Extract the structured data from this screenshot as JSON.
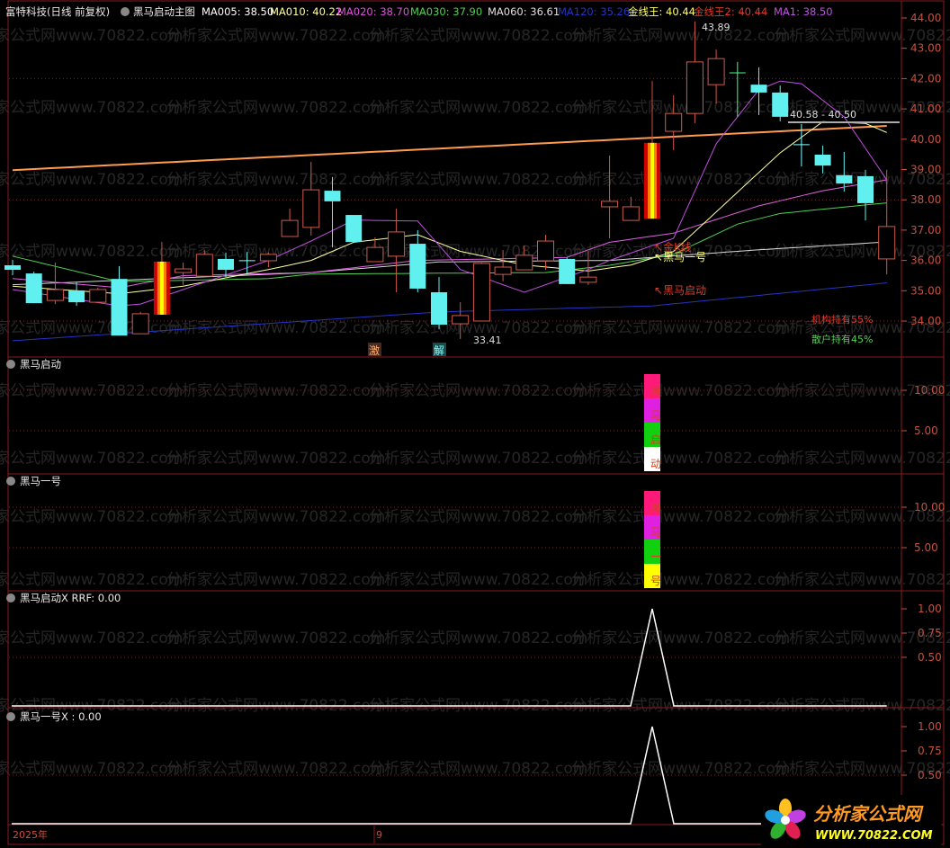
{
  "header": {
    "stock": "富特科技(日线 前复权)",
    "formula": "黑马启动主图",
    "indicators": [
      {
        "label": "MA005: 38.50",
        "color": "#ffffff"
      },
      {
        "label": "MA010: 40.22",
        "color": "#ffffa0"
      },
      {
        "label": "MA020: 38.70",
        "color": "#e050e0"
      },
      {
        "label": "MA030: 37.90",
        "color": "#50d050"
      },
      {
        "label": "MA060: 36.61",
        "color": "#e0e0e0"
      },
      {
        "label": "MA120: 35.26",
        "color": "#2535c0"
      },
      {
        "label": "金线王: 40.44",
        "color": "#ffff70"
      },
      {
        "label": "金线王2: 40.44",
        "color": "#e03a28"
      },
      {
        "label": "MA1: 38.50",
        "color": "#c050e0"
      }
    ]
  },
  "watermark": "分析家公式网www.70822.com",
  "panels": {
    "p2_title": "黑马启动",
    "p3_title": "黑马一号",
    "p4_title": "黑马启动X RRF: 0.00",
    "p5_title": "黑马一号X : 0.00"
  },
  "annotations": {
    "high_label": "43.89",
    "low_label": "33.41",
    "range_label": "40.58 - 40.50",
    "gold_k": "金K线",
    "heima_1": "黑马一号",
    "heima_start": "黑马启动",
    "ji": "激",
    "jie": "解",
    "inst": "机构持有55%",
    "retail": "散户持有45%"
  },
  "date_axis": {
    "year": "2025年",
    "month": "9"
  },
  "logo": {
    "name": "分析家公式网",
    "url": "WWW.70822.COM"
  },
  "chart_data": [
    {
      "type": "candlestick",
      "title": "黑马启动主图",
      "ylim": [
        33.3,
        44.4
      ],
      "yticks": [
        "44.00",
        "43.00",
        "42.00",
        "41.00",
        "40.00",
        "39.00",
        "38.00",
        "37.00",
        "36.00",
        "35.00",
        "34.00"
      ],
      "candles": [
        {
          "o": 35.84,
          "c": 35.69,
          "h": 36.02,
          "l": 35.51
        },
        {
          "o": 35.57,
          "c": 34.59,
          "h": 35.63,
          "l": 34.59
        },
        {
          "o": 34.68,
          "c": 35.04,
          "h": 35.93,
          "l": 34.56
        },
        {
          "o": 35.01,
          "c": 34.62,
          "h": 35.28,
          "l": 34.5
        },
        {
          "o": 34.62,
          "c": 35.04,
          "h": 35.1,
          "l": 34.62
        },
        {
          "o": 35.39,
          "c": 33.52,
          "h": 35.81,
          "l": 33.52
        },
        {
          "o": 33.58,
          "c": 34.24,
          "h": 34.3,
          "l": 33.58
        },
        {
          "o": 34.21,
          "c": 35.96,
          "h": 36.61,
          "l": 34.21,
          "signal": true
        },
        {
          "o": 35.6,
          "c": 35.72,
          "h": 35.93,
          "l": 35.19
        },
        {
          "o": 35.48,
          "c": 36.2,
          "h": 36.34,
          "l": 35.48
        },
        {
          "o": 36.05,
          "c": 35.69,
          "h": 36.26,
          "l": 35.45
        },
        {
          "o": 35.99,
          "c": 35.99,
          "h": 36.28,
          "l": 35.54
        },
        {
          "o": 35.99,
          "c": 36.2,
          "h": 36.26,
          "l": 35.78
        },
        {
          "o": 36.79,
          "c": 37.32,
          "h": 37.71,
          "l": 36.79
        },
        {
          "o": 37.09,
          "c": 38.33,
          "h": 39.25,
          "l": 36.82
        },
        {
          "o": 38.3,
          "c": 37.95,
          "h": 38.75,
          "l": 36.43
        },
        {
          "o": 37.5,
          "c": 36.61,
          "h": 37.5,
          "l": 36.61
        },
        {
          "o": 35.96,
          "c": 36.43,
          "h": 36.76,
          "l": 35.96
        },
        {
          "o": 36.14,
          "c": 36.94,
          "h": 37.71,
          "l": 34.95
        },
        {
          "o": 36.55,
          "c": 35.07,
          "h": 37.0,
          "l": 34.95
        },
        {
          "o": 34.95,
          "c": 33.88,
          "h": 35.45,
          "l": 33.73
        },
        {
          "o": 33.91,
          "c": 34.18,
          "h": 34.62,
          "l": 33.41
        },
        {
          "o": 34.0,
          "c": 35.9,
          "h": 35.93,
          "l": 34.0
        },
        {
          "o": 35.54,
          "c": 35.78,
          "h": 36.34,
          "l": 35.31
        },
        {
          "o": 35.69,
          "c": 36.17,
          "h": 36.49,
          "l": 35.69
        },
        {
          "o": 35.99,
          "c": 36.64,
          "h": 36.85,
          "l": 35.69
        },
        {
          "o": 36.05,
          "c": 35.22,
          "h": 36.1,
          "l": 35.22
        },
        {
          "o": 35.28,
          "c": 35.45,
          "h": 36.31,
          "l": 35.19
        },
        {
          "o": 37.77,
          "c": 37.95,
          "h": 39.46,
          "l": 36.73
        },
        {
          "o": 37.32,
          "c": 37.77,
          "h": 38.1,
          "l": 37.32
        },
        {
          "o": 37.38,
          "c": 39.88,
          "h": 41.92,
          "l": 37.38,
          "signal": true
        },
        {
          "o": 40.26,
          "c": 40.85,
          "h": 41.45,
          "l": 39.64
        },
        {
          "o": 40.85,
          "c": 42.55,
          "h": 43.89,
          "l": 40.53
        },
        {
          "o": 41.8,
          "c": 42.66,
          "h": 42.96,
          "l": 41.18
        },
        {
          "o": 42.19,
          "c": 42.19,
          "h": 42.55,
          "l": 40.74
        },
        {
          "o": 41.8,
          "c": 41.54,
          "h": 42.37,
          "l": 40.8
        },
        {
          "o": 41.54,
          "c": 40.74,
          "h": 41.77,
          "l": 40.59
        },
        {
          "o": 39.82,
          "c": 39.82,
          "h": 40.5,
          "l": 39.1
        },
        {
          "o": 39.49,
          "c": 39.13,
          "h": 39.79,
          "l": 38.87
        },
        {
          "o": 38.81,
          "c": 38.54,
          "h": 39.58,
          "l": 38.27
        },
        {
          "o": 38.78,
          "c": 37.89,
          "h": 38.99,
          "l": 37.32
        },
        {
          "o": 36.05,
          "c": 37.12,
          "h": 38.99,
          "l": 35.54
        }
      ],
      "series": [
        {
          "name": "金线王",
          "color": "#ff9a50",
          "points": [
            [
              0,
              38.98
            ],
            [
              41,
              40.44
            ]
          ]
        },
        {
          "name": "MA120",
          "color": "#2535c0",
          "points": [
            [
              0,
              33.35
            ],
            [
              20,
              34.3
            ],
            [
              30,
              34.5
            ],
            [
              41,
              35.26
            ]
          ]
        },
        {
          "name": "MA060",
          "color": "#d8d8d8",
          "points": [
            [
              0,
              35.2
            ],
            [
              14,
              35.6
            ],
            [
              20,
              35.95
            ],
            [
              28,
              36.0
            ],
            [
              35,
              36.35
            ],
            [
              41,
              36.61
            ]
          ]
        },
        {
          "name": "MA030",
          "color": "#50d050",
          "points": [
            [
              0,
              36.14
            ],
            [
              5,
              35.3
            ],
            [
              12,
              35.4
            ],
            [
              14,
              35.55
            ],
            [
              25,
              35.6
            ],
            [
              28,
              35.84
            ],
            [
              31,
              36.2
            ],
            [
              34,
              37.2
            ],
            [
              36,
              37.55
            ],
            [
              41,
              37.9
            ]
          ]
        },
        {
          "name": "MA020",
          "color": "#e060e0",
          "points": [
            [
              0,
              35.4
            ],
            [
              5,
              35.1
            ],
            [
              8,
              35.5
            ],
            [
              14,
              35.6
            ],
            [
              19,
              36.0
            ],
            [
              26,
              36.1
            ],
            [
              28,
              36.6
            ],
            [
              31,
              36.9
            ],
            [
              35,
              37.8
            ],
            [
              38,
              38.3
            ],
            [
              41,
              38.66
            ]
          ]
        },
        {
          "name": "MA010",
          "color": "#ffffa0",
          "points": [
            [
              0,
              35.15
            ],
            [
              5,
              34.9
            ],
            [
              8,
              35.15
            ],
            [
              12,
              35.7
            ],
            [
              14,
              36.0
            ],
            [
              16,
              36.6
            ],
            [
              19,
              36.85
            ],
            [
              21,
              36.3
            ],
            [
              24,
              35.85
            ],
            [
              27,
              35.65
            ],
            [
              29,
              35.85
            ],
            [
              31,
              36.3
            ],
            [
              33,
              37.6
            ],
            [
              36,
              39.55
            ],
            [
              38,
              40.58
            ],
            [
              40,
              40.52
            ],
            [
              41,
              40.22
            ]
          ]
        },
        {
          "name": "MA1",
          "color": "#c050e0",
          "points": [
            [
              0,
              35.04
            ],
            [
              5,
              34.5
            ],
            [
              6,
              34.56
            ],
            [
              8,
              35.04
            ],
            [
              12,
              36.0
            ],
            [
              14,
              36.64
            ],
            [
              16,
              37.33
            ],
            [
              19,
              37.3
            ],
            [
              21,
              35.7
            ],
            [
              24,
              34.95
            ],
            [
              27,
              35.7
            ],
            [
              28,
              36.0
            ],
            [
              31,
              36.73
            ],
            [
              33,
              39.85
            ],
            [
              35,
              41.63
            ],
            [
              36,
              41.92
            ],
            [
              37,
              41.83
            ],
            [
              39,
              40.74
            ],
            [
              41,
              38.66
            ]
          ]
        }
      ]
    },
    {
      "type": "bar",
      "title": "黑马启动",
      "ylim": [
        0,
        13
      ],
      "yticks": [
        "10.00",
        "5.00"
      ],
      "index": 30,
      "segments": [
        {
          "char": "黑",
          "value": 3,
          "color": "#ff1a7a"
        },
        {
          "char": "马",
          "value": 3,
          "color": "#e020e0"
        },
        {
          "char": "启",
          "value": 3,
          "color": "#10d010"
        },
        {
          "char": "动",
          "value": 3,
          "color": "#ffffff"
        }
      ]
    },
    {
      "type": "bar",
      "title": "黑马一号",
      "ylim": [
        0,
        13
      ],
      "yticks": [
        "10.00",
        "5.00"
      ],
      "index": 30,
      "segments": [
        {
          "char": "黑",
          "value": 3,
          "color": "#ff1a7a"
        },
        {
          "char": "马",
          "value": 3,
          "color": "#e020e0"
        },
        {
          "char": "一",
          "value": 3,
          "color": "#10d010"
        },
        {
          "char": "号",
          "value": 3,
          "color": "#ffff00"
        }
      ]
    },
    {
      "type": "line",
      "title": "黑马启动X RRF: 0.00",
      "ylim": [
        0,
        1.15
      ],
      "yticks": [
        "1.00",
        "0.75",
        "0.50"
      ],
      "spike_index": 30,
      "spike_value": 1.0
    },
    {
      "type": "line",
      "title": "黑马一号X : 0.00",
      "ylim": [
        0,
        1.15
      ],
      "yticks": [
        "1.00",
        "0.75",
        "0.50"
      ],
      "spike_index": 30,
      "spike_value": 1.0
    }
  ]
}
